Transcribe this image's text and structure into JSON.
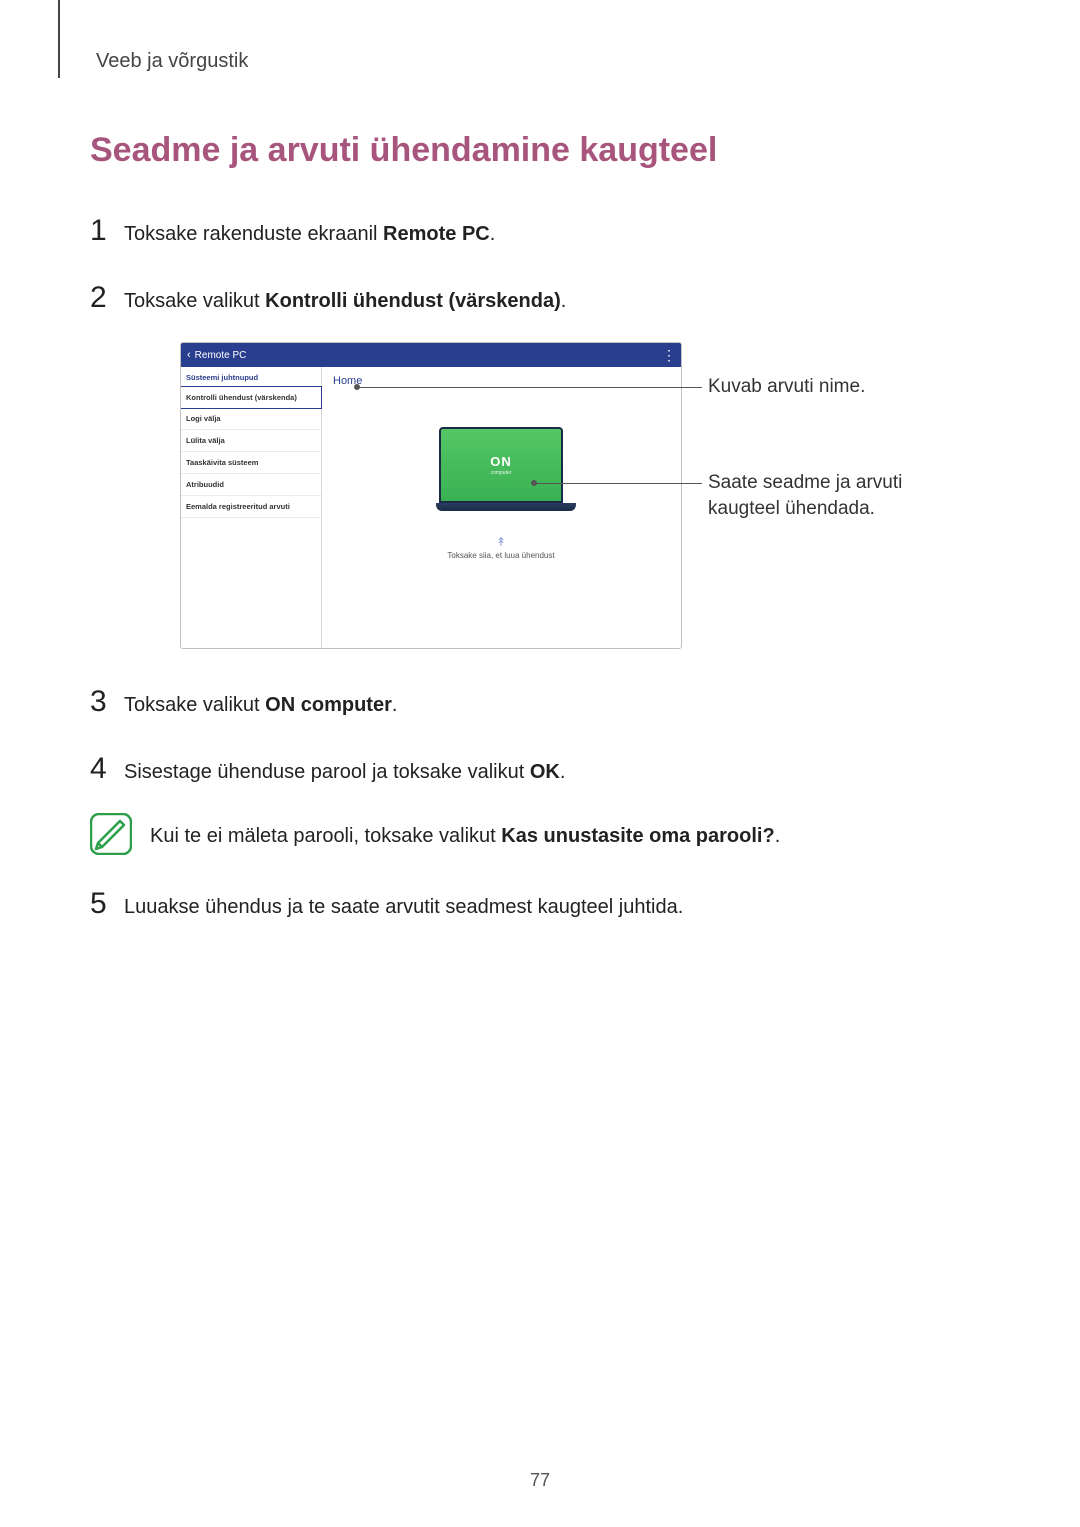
{
  "header": {
    "section": "Veeb ja võrgustik"
  },
  "title": "Seadme ja arvuti ühendamine kaugteel",
  "steps": {
    "s1": {
      "num": "1",
      "pre": "Toksake rakenduste ekraanil ",
      "bold": "Remote PC",
      "post": "."
    },
    "s2": {
      "num": "2",
      "pre": "Toksake valikut ",
      "bold": "Kontrolli ühendust (värskenda)",
      "post": "."
    },
    "s3": {
      "num": "3",
      "pre": "Toksake valikut ",
      "bold": "ON computer",
      "post": "."
    },
    "s4": {
      "num": "4",
      "pre": "Sisestage ühenduse parool ja toksake valikut ",
      "bold": "OK",
      "post": "."
    },
    "s5": {
      "num": "5",
      "pre": "Luuakse ühendus ja te saate arvutit seadmest kaugteel juhtida.",
      "bold": "",
      "post": ""
    }
  },
  "note": {
    "pre": "Kui te ei mäleta parooli, toksake valikut ",
    "bold": "Kas unustasite oma parooli?",
    "post": "."
  },
  "figure": {
    "titlebar": "Remote PC",
    "sidebar": {
      "header": "Süsteemi juhtnupud",
      "items": [
        "Kontrolli ühendust (värskenda)",
        "Logi välja",
        "Lülita välja",
        "Taaskäivita süsteem",
        "Atribuudid",
        "Eemalda registreeritud arvuti"
      ]
    },
    "home": "Home",
    "on": "ON",
    "on_sub": "computer",
    "tap_hint": "Toksake siia, et luua ühendust"
  },
  "callouts": {
    "c1": "Kuvab arvuti nime.",
    "c2": "Saate seadme ja arvuti kaugteel ühendada."
  },
  "page_number": "77"
}
